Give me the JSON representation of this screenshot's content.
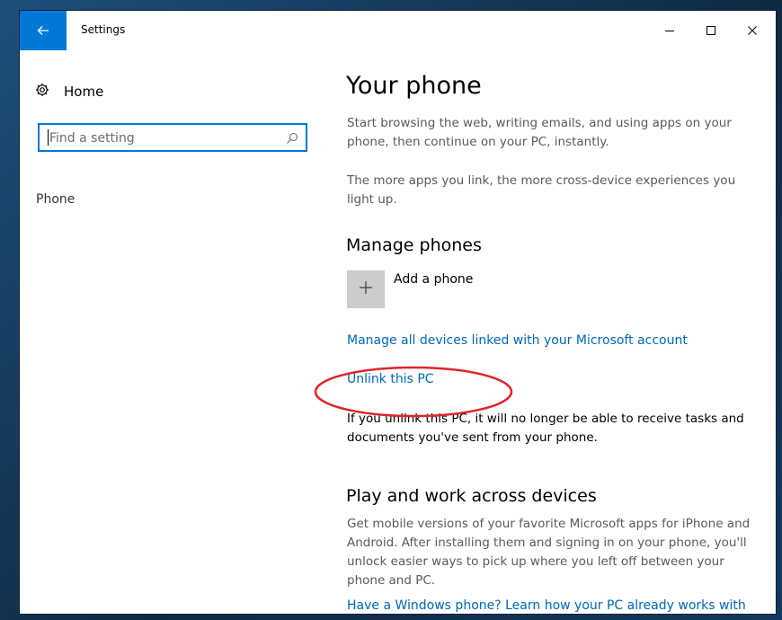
{
  "window": {
    "title": "Settings",
    "controls": [
      "minimize",
      "maximize",
      "close"
    ]
  },
  "sidebar": {
    "home_label": "Home",
    "search": {
      "placeholder": "Find a setting",
      "value": ""
    },
    "items": [
      {
        "label": "Phone"
      }
    ]
  },
  "main": {
    "title": "Your phone",
    "intro": "Start browsing the web, writing emails, and using apps on your phone, then continue on your PC, instantly.",
    "intro2": "The more apps you link, the more cross-device experiences you light up.",
    "manage": {
      "heading": "Manage phones",
      "add_label": "Add a phone",
      "manage_link": "Manage all devices linked with your Microsoft account",
      "unlink_link": "Unlink this PC",
      "unlink_desc": "If you unlink this PC, it will no longer be able to receive tasks and documents you've sent from your phone."
    },
    "play": {
      "heading": "Play and work across devices",
      "desc": "Get mobile versions of your favorite Microsoft apps for iPhone and Android. After installing them and signing in on your phone, you'll unlock easier ways to pick up where you left off between your phone and PC.",
      "link": "Have a Windows phone? Learn how your PC already works with"
    }
  },
  "colors": {
    "accent": "#0078d7",
    "link": "#0067b8",
    "annotation": "#e0242b",
    "tile": "#cccccc"
  },
  "icons": {
    "back": "arrow-left-icon",
    "home": "gear-icon",
    "search": "search-icon",
    "add": "plus-icon",
    "minimize": "minimize-icon",
    "maximize": "maximize-icon",
    "close": "close-icon"
  }
}
